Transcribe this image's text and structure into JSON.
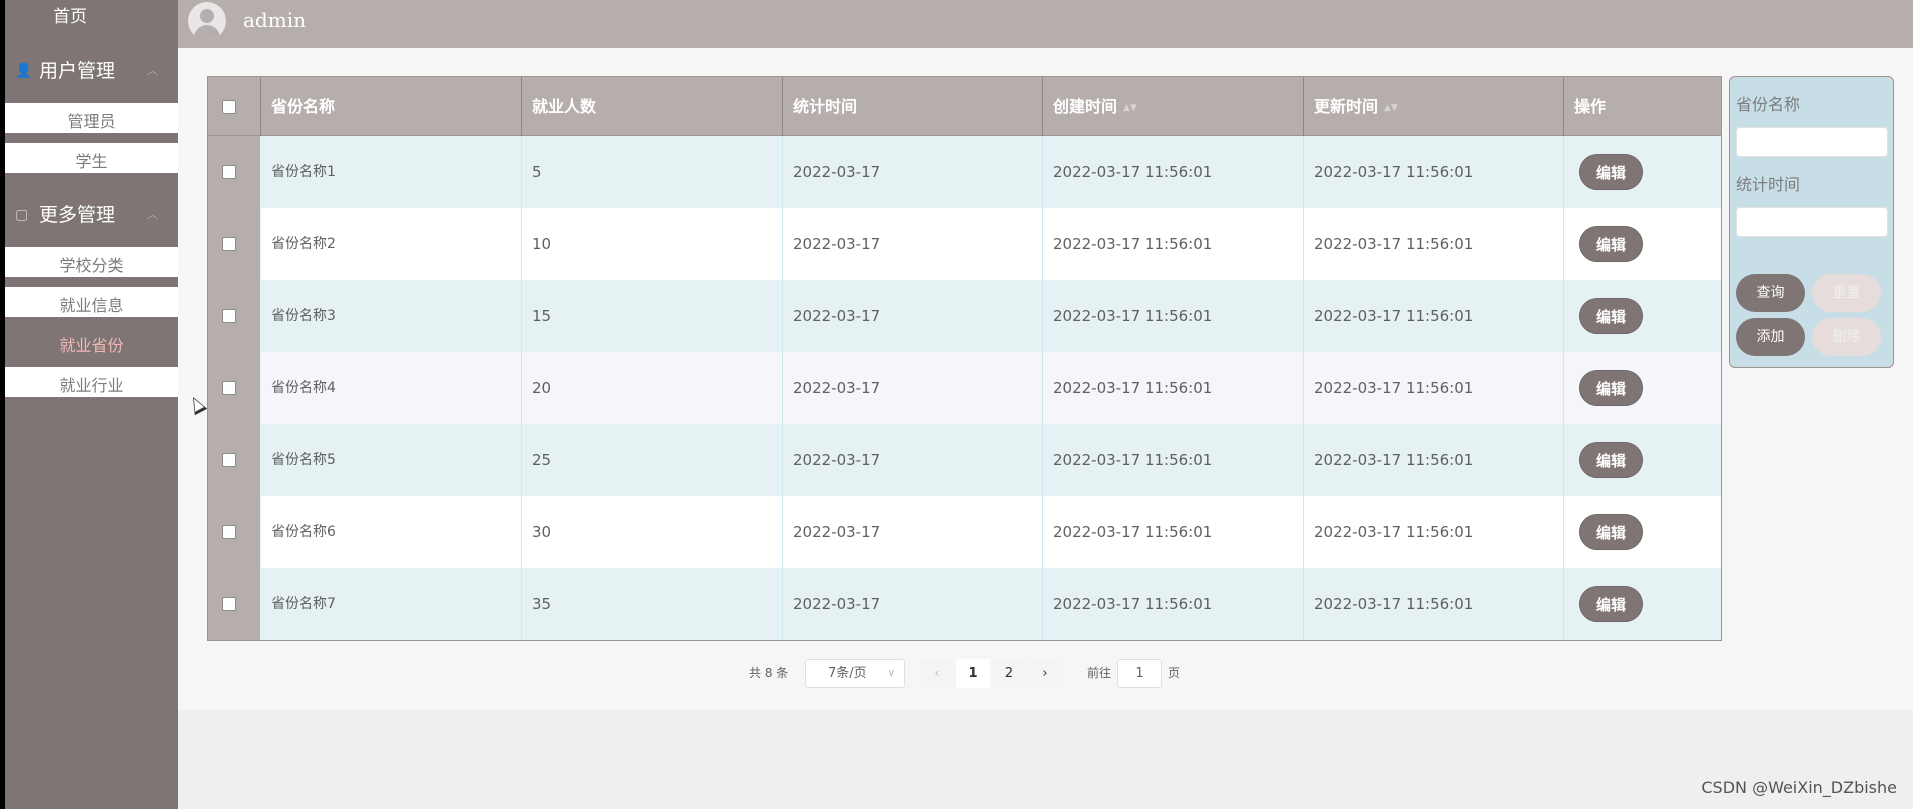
{
  "sidebar": {
    "home": "首页",
    "group1": {
      "label": "用户管理",
      "overlay": "学生"
    },
    "group1_items": [
      {
        "label": "管理员"
      },
      {
        "label": "学生"
      }
    ],
    "group2": {
      "label": "更多管理"
    },
    "group2_items": [
      {
        "label": "学校分类"
      },
      {
        "label": "就业信息"
      },
      {
        "label": "就业省份",
        "active": true
      },
      {
        "label": "就业行业"
      }
    ]
  },
  "header": {
    "username": "admin"
  },
  "table": {
    "columns": [
      {
        "label": ""
      },
      {
        "label": "省份名称"
      },
      {
        "label": "就业人数"
      },
      {
        "label": "统计时间"
      },
      {
        "label": "创建时间",
        "sortable": true
      },
      {
        "label": "更新时间",
        "sortable": true
      },
      {
        "label": "操作"
      }
    ],
    "edit_label": "编辑",
    "rows": [
      {
        "name": "省份名称1",
        "count": "5",
        "stat_date": "2022-03-17",
        "created": "2022-03-17 11:56:01",
        "updated": "2022-03-17 11:56:01"
      },
      {
        "name": "省份名称2",
        "count": "10",
        "stat_date": "2022-03-17",
        "created": "2022-03-17 11:56:01",
        "updated": "2022-03-17 11:56:01"
      },
      {
        "name": "省份名称3",
        "count": "15",
        "stat_date": "2022-03-17",
        "created": "2022-03-17 11:56:01",
        "updated": "2022-03-17 11:56:01"
      },
      {
        "name": "省份名称4",
        "count": "20",
        "stat_date": "2022-03-17",
        "created": "2022-03-17 11:56:01",
        "updated": "2022-03-17 11:56:01"
      },
      {
        "name": "省份名称5",
        "count": "25",
        "stat_date": "2022-03-17",
        "created": "2022-03-17 11:56:01",
        "updated": "2022-03-17 11:56:01"
      },
      {
        "name": "省份名称6",
        "count": "30",
        "stat_date": "2022-03-17",
        "created": "2022-03-17 11:56:01",
        "updated": "2022-03-17 11:56:01"
      },
      {
        "name": "省份名称7",
        "count": "35",
        "stat_date": "2022-03-17",
        "created": "2022-03-17 11:56:01",
        "updated": "2022-03-17 11:56:01"
      }
    ]
  },
  "pagination": {
    "total": "共 8 条",
    "page_size": "7条/页",
    "prev": "‹",
    "next": "›",
    "pages": [
      "1",
      "2"
    ],
    "current_page": "1",
    "goto_prefix": "前往",
    "goto_value": "1",
    "goto_suffix": "页"
  },
  "search": {
    "field1_label": "省份名称",
    "field1_value": "",
    "field2_label": "统计时间",
    "field2_value": "",
    "query": "查询",
    "reset": "重置",
    "add": "添加",
    "delete": "删除"
  },
  "watermark": "CSDN @WeiXin_DZbishe",
  "colors": {
    "sidebar_bg": "#7e7574",
    "header_bg": "#b6aeac",
    "row_tint": "#e6f1f3",
    "active_menu_text": "#f2b8b5",
    "search_panel_bg": "#c7dee7"
  }
}
